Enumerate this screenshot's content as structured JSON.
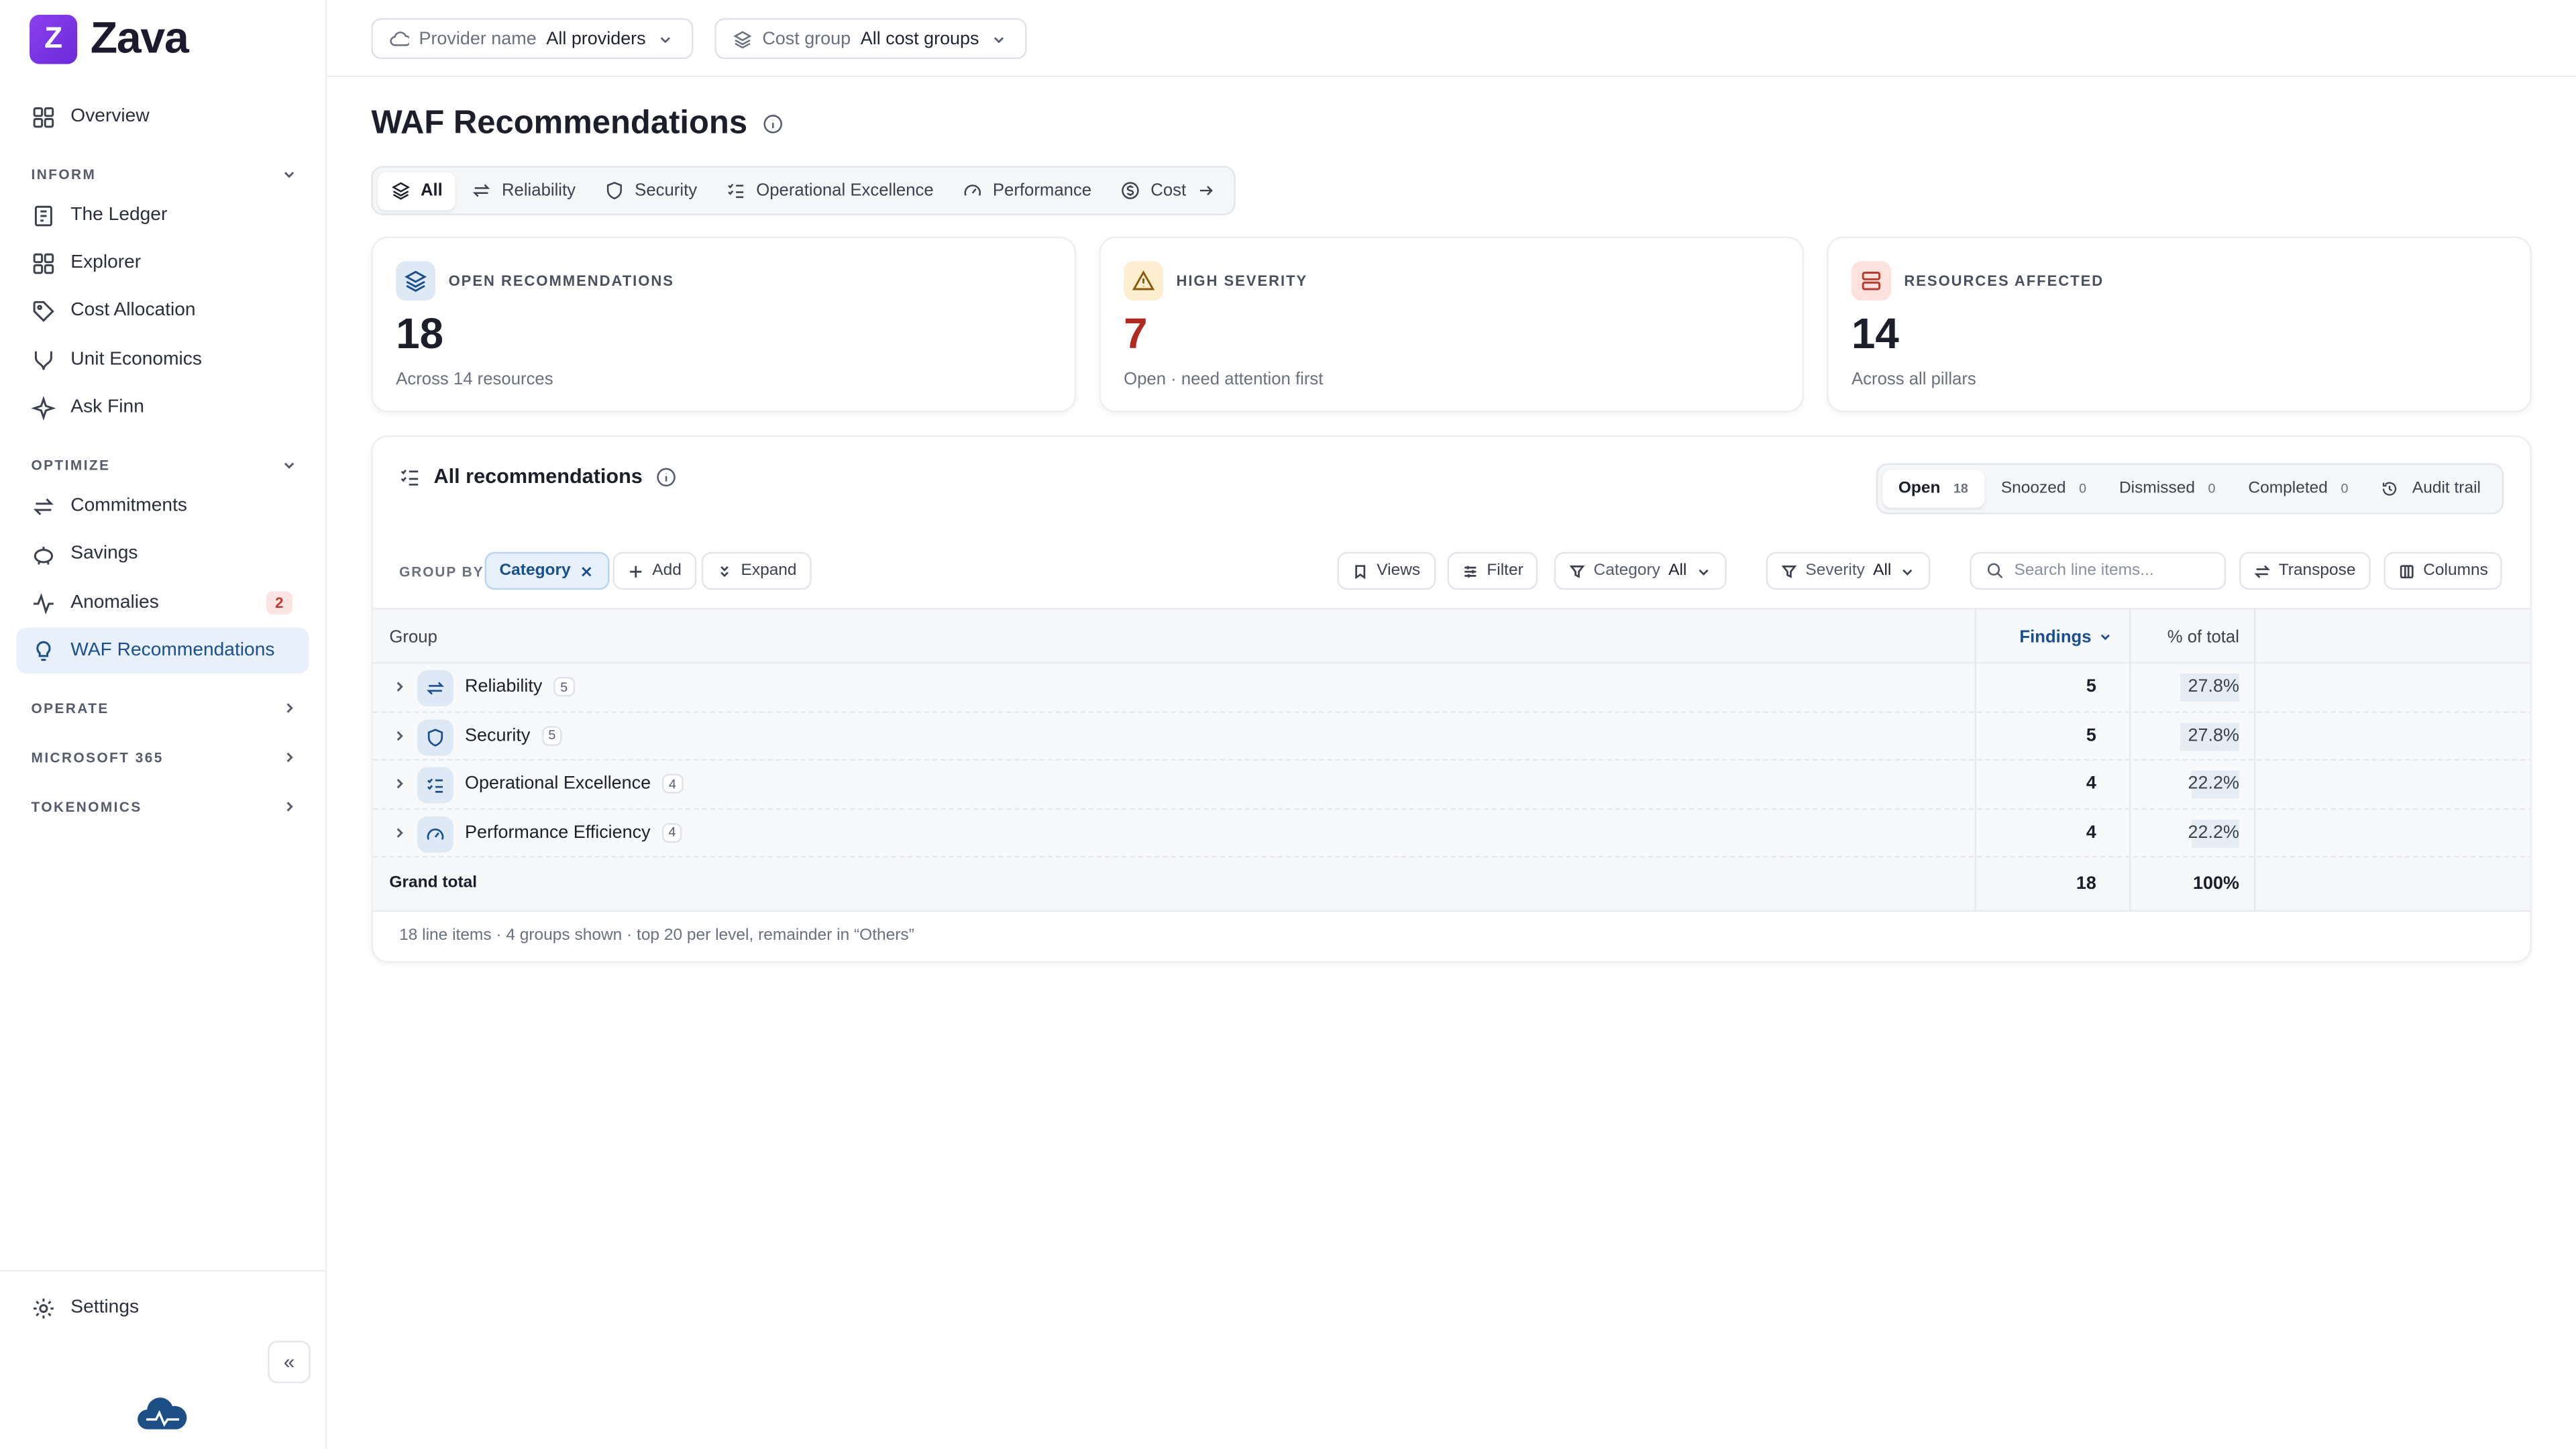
{
  "brand": {
    "logo_letter": "Z",
    "name": "Zava"
  },
  "sidebar": {
    "overview": "Overview",
    "inform": {
      "title": "INFORM",
      "items": [
        "The Ledger",
        "Explorer",
        "Cost Allocation",
        "Unit Economics",
        "Ask Finn"
      ]
    },
    "optimize": {
      "title": "OPTIMIZE",
      "items": [
        "Commitments",
        "Savings",
        "Anomalies",
        "WAF Recommendations"
      ],
      "anomalies_badge": "2"
    },
    "operate": "OPERATE",
    "microsoft365": "MICROSOFT 365",
    "tokenomics": "TOKENOMICS",
    "settings": "Settings",
    "collapse_glyph": "«"
  },
  "topbar": {
    "provider": {
      "label": "Provider name",
      "value": "All providers"
    },
    "cost_group": {
      "label": "Cost group",
      "value": "All cost groups"
    }
  },
  "page": {
    "title": "WAF Recommendations"
  },
  "tabs": [
    "All",
    "Reliability",
    "Security",
    "Operational Excellence",
    "Performance",
    "Cost"
  ],
  "cards": [
    {
      "label": "OPEN RECOMMENDATIONS",
      "value": "18",
      "sub": "Across 14 resources"
    },
    {
      "label": "HIGH SEVERITY",
      "value": "7",
      "sub": "Open · need attention first"
    },
    {
      "label": "RESOURCES AFFECTED",
      "value": "14",
      "sub": "Across all pillars"
    }
  ],
  "panel": {
    "title": "All recommendations",
    "status": {
      "open": {
        "label": "Open",
        "count": "18"
      },
      "snoozed": {
        "label": "Snoozed",
        "count": "0"
      },
      "dismissed": {
        "label": "Dismissed",
        "count": "0"
      },
      "completed": {
        "label": "Completed",
        "count": "0"
      },
      "audit": "Audit trail"
    },
    "toolbar": {
      "group_by": "GROUP BY",
      "category_chip": "Category",
      "add": "Add",
      "expand": "Expand",
      "views": "Views",
      "filter": "Filter",
      "category_filter": {
        "label": "Category",
        "value": "All"
      },
      "severity_filter": {
        "label": "Severity",
        "value": "All"
      },
      "search_placeholder": "Search line items...",
      "transpose": "Transpose",
      "columns": "Columns"
    },
    "table": {
      "headers": {
        "group": "Group",
        "findings": "Findings",
        "pct": "% of total"
      },
      "rows": [
        {
          "name": "Reliability",
          "badge": "5",
          "findings": "5",
          "pct": "27.8%",
          "share": 0.278
        },
        {
          "name": "Security",
          "badge": "5",
          "findings": "5",
          "pct": "27.8%",
          "share": 0.278
        },
        {
          "name": "Operational Excellence",
          "badge": "4",
          "findings": "4",
          "pct": "22.2%",
          "share": 0.222
        },
        {
          "name": "Performance Efficiency",
          "badge": "4",
          "findings": "4",
          "pct": "22.2%",
          "share": 0.222
        }
      ],
      "total": {
        "label": "Grand total",
        "findings": "18",
        "pct": "100%"
      }
    },
    "footnote": "18 line items · 4 groups shown · top 20 per level, remainder in “Others”"
  }
}
